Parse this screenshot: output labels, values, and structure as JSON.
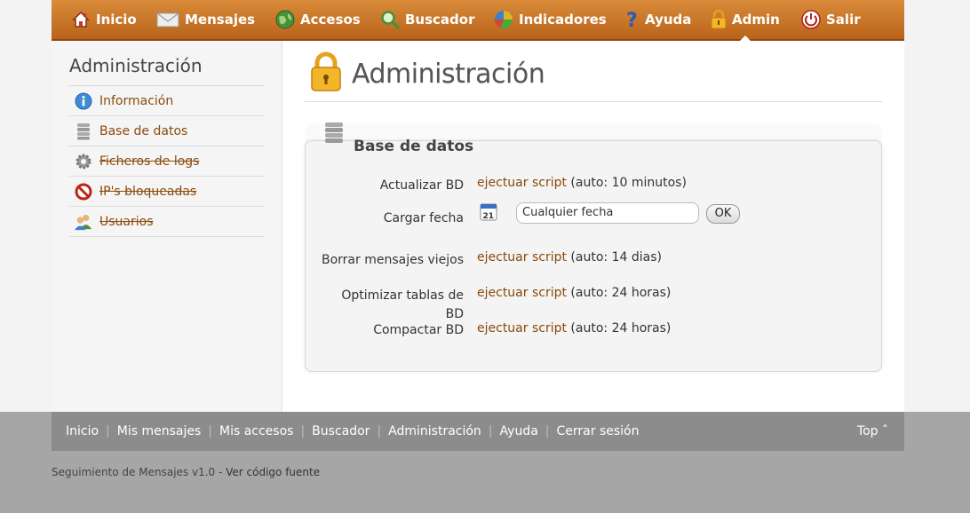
{
  "nav": {
    "items": [
      {
        "label": "Inicio",
        "icon": "home-icon"
      },
      {
        "label": "Mensajes",
        "icon": "envelope-icon"
      },
      {
        "label": "Accesos",
        "icon": "globe-icon"
      },
      {
        "label": "Buscador",
        "icon": "magnifier-icon"
      },
      {
        "label": "Indicadores",
        "icon": "pie-chart-icon"
      },
      {
        "label": "Ayuda",
        "icon": "question-icon"
      },
      {
        "label": "Admin",
        "icon": "lock-icon",
        "active": true
      },
      {
        "label": "Salir",
        "icon": "power-icon"
      }
    ]
  },
  "sidebar": {
    "title": "Administración",
    "items": [
      {
        "label": "Información",
        "icon": "info-icon",
        "strike": false
      },
      {
        "label": "Base de datos",
        "icon": "database-icon",
        "strike": false
      },
      {
        "label": "Ficheros de logs",
        "icon": "gear-icon",
        "strike": true
      },
      {
        "label": "IP's bloqueadas",
        "icon": "blocked-icon",
        "strike": true
      },
      {
        "label": "Usuarios",
        "icon": "users-icon",
        "strike": true
      }
    ]
  },
  "main": {
    "title": "Administración",
    "panel": {
      "title": "Base de datos",
      "rows": [
        {
          "label": "Actualizar BD",
          "link": "ejectuar script",
          "note": " (auto: 10 minutos)"
        },
        {
          "label": "Cargar fecha",
          "date_value": "Cualquier fecha",
          "ok_label": "OK"
        },
        {
          "label": "Borrar mensajes viejos",
          "link": "ejectuar script",
          "note": " (auto: 14 dias)"
        },
        {
          "label": "Optimizar tablas de BD",
          "link": "ejectuar script",
          "note": " (auto: 24 horas)"
        },
        {
          "label": "Compactar BD",
          "link": "ejectuar script",
          "note": " (auto: 24 horas)"
        }
      ]
    }
  },
  "footer": {
    "links": [
      "Inicio",
      "Mis mensajes",
      "Mis accesos",
      "Buscador",
      "Administración",
      "Ayuda",
      "Cerrar sesión"
    ],
    "top_label": "Top ˆ"
  },
  "bottom": {
    "text": "Seguimiento de Mensajes v1.0 - ",
    "link": "Ver código fuente"
  },
  "colors": {
    "nav_orange": "#c8732a",
    "link_brown": "#8a4a0c",
    "footer_gray": "#8c8c8c"
  }
}
